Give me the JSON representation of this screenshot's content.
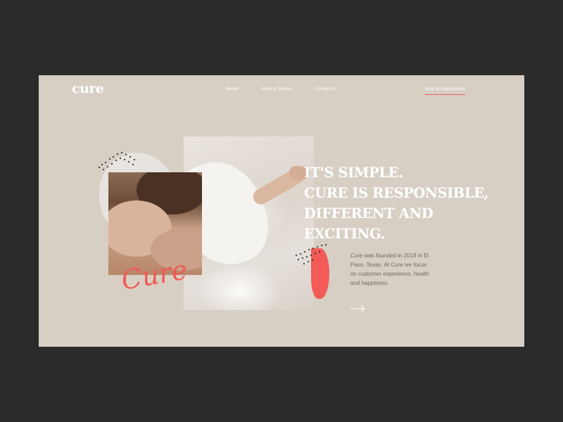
{
  "header": {
    "logo": "cure",
    "nav": [
      "Menus",
      "About & Careers",
      "Contact Us"
    ],
    "cta": "Book an Appointment"
  },
  "hero": {
    "headline": [
      "IT'S SIMPLE.",
      "CURE IS  RESPONSIBLE,",
      "DIFFERENT AND",
      "EXCITING."
    ],
    "description": "Cure was founded in 2018 in El Paso, Texas. At Cure we focus on customer experience, health and happiness.",
    "signature": "Cure",
    "arrow_icon": "arrow-right-icon"
  },
  "colors": {
    "background": "#2b2b2b",
    "page": "#d7cfc4",
    "accent": "#f25b57",
    "text_light": "#ffffff",
    "text_body": "#6e6a66"
  }
}
